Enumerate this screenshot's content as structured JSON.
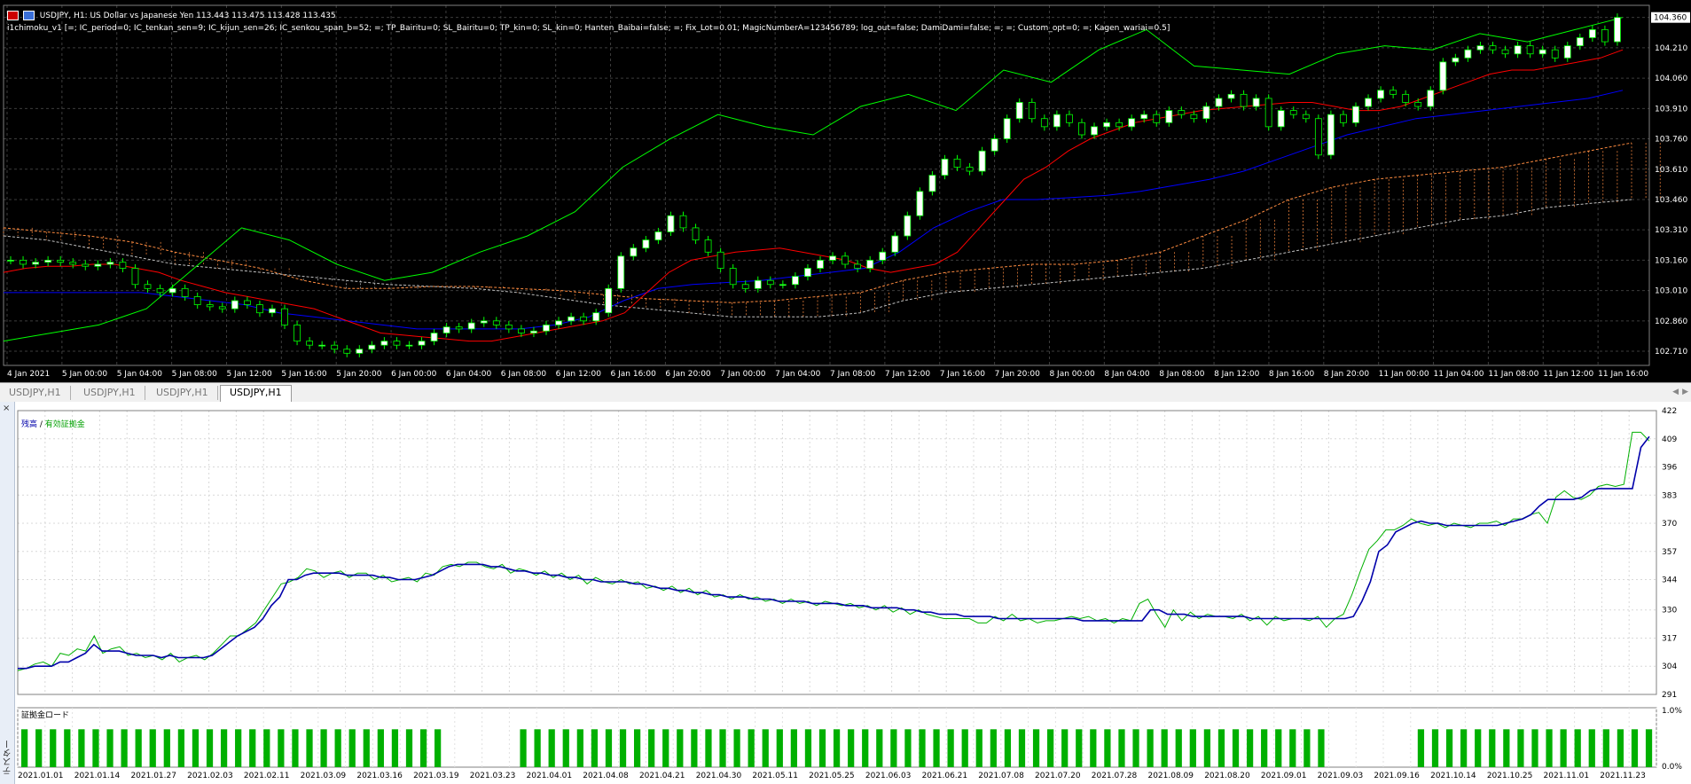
{
  "window": {
    "title_line": "USDJPY, H1:  US Dollar vs Japanese Yen  113.443 113.475 113.428 113.435",
    "indicator_line": "i1chimoku_v1 [=; IC_period=0; IC_tenkan_sen=9; IC_kijun_sen=26; IC_senkou_span_b=52; =; TP_Bairitu=0; SL_Bairitu=0; TP_kin=0; SL_kin=0; Hanten_Baibai=false; =; Fix_Lot=0.01; MagicNumberA=123456789; log_out=false; DamiDami=false; =; =; Custom_opt=0; =; Kagen_wariai=0.5]"
  },
  "price_axis": {
    "labels": [
      "104.360",
      "104.210",
      "104.060",
      "103.910",
      "103.760",
      "103.610",
      "103.460",
      "103.310",
      "103.160",
      "103.010",
      "102.860",
      "102.710"
    ],
    "current_price": "104.360"
  },
  "time_axis": {
    "labels": [
      "4 Jan 2021",
      "5 Jan 00:00",
      "5 Jan 04:00",
      "5 Jan 08:00",
      "5 Jan 12:00",
      "5 Jan 16:00",
      "5 Jan 20:00",
      "6 Jan 00:00",
      "6 Jan 04:00",
      "6 Jan 08:00",
      "6 Jan 12:00",
      "6 Jan 16:00",
      "6 Jan 20:00",
      "7 Jan 00:00",
      "7 Jan 04:00",
      "7 Jan 08:00",
      "7 Jan 12:00",
      "7 Jan 16:00",
      "7 Jan 20:00",
      "8 Jan 00:00",
      "8 Jan 04:00",
      "8 Jan 08:00",
      "8 Jan 12:00",
      "8 Jan 16:00",
      "8 Jan 20:00",
      "11 Jan 00:00",
      "11 Jan 04:00",
      "11 Jan 08:00",
      "11 Jan 12:00",
      "11 Jan 16:00"
    ]
  },
  "tabs": [
    {
      "label": "USDJPY,H1",
      "active": false
    },
    {
      "label": "USDJPY,H1",
      "active": false
    },
    {
      "label": "USDJPY,H1",
      "active": false
    },
    {
      "label": "USDJPY,H1",
      "active": true
    }
  ],
  "tester": {
    "side_label": "テスター",
    "close_symbol": "×",
    "balance_legend_a": "残高",
    "balance_legend_sep": " / ",
    "balance_legend_b": "有効証拠金",
    "margin_legend": "証拠金ロード",
    "balance_axis": [
      "422",
      "409",
      "396",
      "383",
      "370",
      "357",
      "344",
      "330",
      "317",
      "304",
      "291"
    ],
    "margin_axis": [
      "1.0%",
      "0.0%"
    ],
    "date_labels": [
      "2021.01.01",
      "2021.01.14",
      "2021.01.27",
      "2021.02.03",
      "2021.02.11",
      "2021.03.09",
      "2021.03.16",
      "2021.03.19",
      "2021.03.23",
      "2021.04.01",
      "2021.04.08",
      "2021.04.21",
      "2021.04.30",
      "2021.05.11",
      "2021.05.25",
      "2021.06.03",
      "2021.06.21",
      "2021.07.08",
      "2021.07.20",
      "2021.07.28",
      "2021.08.09",
      "2021.08.20",
      "2021.09.01",
      "2021.09.03",
      "2021.09.16",
      "2021.10.14",
      "2021.10.25",
      "2021.11.01",
      "2021.11.23"
    ]
  },
  "colors": {
    "bull_candle": "#ffffff",
    "bear_candle": "#000000",
    "candle_outline": "#00ff00",
    "tenkan": "#ff0000",
    "kijun": "#0000ff",
    "chikou": "#00ff00",
    "cloud_a": "#ff8c40",
    "cloud_b": "#c0c0c0",
    "balance": "#0000aa",
    "equity": "#00b000",
    "margin_bar": "#00b000"
  },
  "chart_data": [
    {
      "type": "candlestick",
      "title": "USDJPY, H1",
      "ylim": [
        102.64,
        104.42
      ],
      "x_range": [
        "4 Jan 2021",
        "11 Jan 16:00"
      ],
      "grid": true,
      "open": [
        103.16,
        103.16,
        103.14,
        103.15,
        103.16,
        103.15,
        103.14,
        103.13,
        103.14,
        103.15,
        103.12,
        103.04,
        103.02,
        103.0,
        103.02,
        102.98,
        102.94,
        102.93,
        102.92,
        102.96,
        102.94,
        102.9,
        102.92,
        102.84,
        102.76,
        102.74,
        102.74,
        102.72,
        102.7,
        102.72,
        102.74,
        102.76,
        102.74,
        102.74,
        102.76,
        102.8,
        102.83,
        102.82,
        102.85,
        102.86,
        102.84,
        102.82,
        102.8,
        102.81,
        102.84,
        102.86,
        102.88,
        102.86,
        102.9,
        103.02,
        103.18,
        103.22,
        103.26,
        103.3,
        103.38,
        103.32,
        103.26,
        103.2,
        103.12,
        103.04,
        103.02,
        103.06,
        103.04,
        103.04,
        103.08,
        103.12,
        103.16,
        103.18,
        103.14,
        103.12,
        103.16,
        103.2,
        103.28,
        103.38,
        103.5,
        103.58,
        103.66,
        103.62,
        103.6,
        103.7,
        103.76,
        103.86,
        103.94,
        103.86,
        103.82,
        103.88,
        103.84,
        103.78,
        103.82,
        103.84,
        103.82,
        103.86,
        103.88,
        103.84,
        103.9,
        103.88,
        103.86,
        103.92,
        103.96,
        103.98,
        103.92,
        103.96,
        103.82,
        103.9,
        103.88,
        103.86,
        103.68,
        103.88,
        103.84,
        103.92,
        103.96,
        104.0,
        103.98,
        103.94,
        103.92,
        104.0,
        104.14,
        104.16,
        104.2,
        104.22,
        104.2,
        104.18,
        104.22,
        104.18,
        104.2,
        104.16,
        104.22,
        104.26,
        104.3,
        104.24
      ],
      "close": [
        103.16,
        103.14,
        103.15,
        103.16,
        103.15,
        103.14,
        103.13,
        103.14,
        103.15,
        103.12,
        103.04,
        103.02,
        103.0,
        103.02,
        102.98,
        102.94,
        102.93,
        102.92,
        102.96,
        102.94,
        102.9,
        102.92,
        102.84,
        102.76,
        102.74,
        102.74,
        102.72,
        102.7,
        102.72,
        102.74,
        102.76,
        102.74,
        102.74,
        102.76,
        102.8,
        102.83,
        102.82,
        102.85,
        102.86,
        102.84,
        102.82,
        102.8,
        102.81,
        102.84,
        102.86,
        102.88,
        102.86,
        102.9,
        103.02,
        103.18,
        103.22,
        103.26,
        103.3,
        103.38,
        103.32,
        103.26,
        103.2,
        103.12,
        103.04,
        103.02,
        103.06,
        103.04,
        103.04,
        103.08,
        103.12,
        103.16,
        103.18,
        103.14,
        103.12,
        103.16,
        103.2,
        103.28,
        103.38,
        103.5,
        103.58,
        103.66,
        103.62,
        103.6,
        103.7,
        103.76,
        103.86,
        103.94,
        103.86,
        103.82,
        103.88,
        103.84,
        103.78,
        103.82,
        103.84,
        103.82,
        103.86,
        103.88,
        103.84,
        103.9,
        103.88,
        103.86,
        103.92,
        103.96,
        103.98,
        103.92,
        103.96,
        103.82,
        103.9,
        103.88,
        103.86,
        103.68,
        103.88,
        103.84,
        103.92,
        103.96,
        104.0,
        103.98,
        103.94,
        103.92,
        104.0,
        104.14,
        104.16,
        104.2,
        104.22,
        104.2,
        104.18,
        104.22,
        104.18,
        104.2,
        104.16,
        104.22,
        104.26,
        104.3,
        104.24,
        104.36
      ],
      "tenkan": [
        103.1,
        103.12,
        103.13,
        103.13,
        103.14,
        103.14,
        103.12,
        103.1,
        103.06,
        103.03,
        103.0,
        102.98,
        102.96,
        102.94,
        102.92,
        102.88,
        102.84,
        102.8,
        102.79,
        102.78,
        102.77,
        102.76,
        102.76,
        102.78,
        102.8,
        102.82,
        102.84,
        102.86,
        102.9,
        103.0,
        103.1,
        103.16,
        103.18,
        103.2,
        103.21,
        103.22,
        103.2,
        103.18,
        103.16,
        103.12,
        103.1,
        103.12,
        103.14,
        103.2,
        103.32,
        103.44,
        103.56,
        103.62,
        103.7,
        103.76,
        103.8,
        103.84,
        103.86,
        103.88,
        103.9,
        103.91,
        103.92,
        103.93,
        103.94,
        103.94,
        103.92,
        103.9,
        103.9,
        103.92,
        103.96,
        104.0,
        104.04,
        104.08,
        104.1,
        104.1,
        104.12,
        104.14,
        104.16,
        104.2
      ],
      "kijun": [
        103.0,
        103.0,
        103.0,
        103.0,
        103.0,
        102.98,
        102.96,
        102.94,
        102.9,
        102.88,
        102.86,
        102.84,
        102.82,
        102.82,
        102.82,
        102.82,
        102.84,
        102.88,
        102.96,
        103.02,
        103.04,
        103.05,
        103.06,
        103.08,
        103.1,
        103.12,
        103.2,
        103.32,
        103.4,
        103.46,
        103.46,
        103.47,
        103.48,
        103.5,
        103.53,
        103.56,
        103.6,
        103.66,
        103.72,
        103.78,
        103.82,
        103.86,
        103.88,
        103.9,
        103.92,
        103.94,
        103.96,
        104.0
      ],
      "chikou": [
        102.76,
        102.8,
        102.84,
        102.92,
        103.12,
        103.32,
        103.26,
        103.14,
        103.06,
        103.1,
        103.2,
        103.28,
        103.4,
        103.62,
        103.76,
        103.88,
        103.82,
        103.78,
        103.92,
        103.98,
        103.9,
        104.1,
        104.04,
        104.2,
        104.3,
        104.12,
        104.1,
        104.08,
        104.18,
        104.22,
        104.2,
        104.28,
        104.24,
        104.3,
        104.36
      ],
      "senkou_a": [
        103.32,
        103.3,
        103.28,
        103.25,
        103.2,
        103.16,
        103.12,
        103.06,
        103.02,
        103.02,
        103.03,
        103.03,
        103.02,
        103.01,
        102.99,
        102.97,
        102.96,
        102.95,
        102.96,
        102.98,
        103.0,
        103.06,
        103.1,
        103.12,
        103.14,
        103.14,
        103.16,
        103.2,
        103.28,
        103.36,
        103.46,
        103.52,
        103.56,
        103.58,
        103.6,
        103.62,
        103.66,
        103.7,
        103.74
      ],
      "senkou_b": [
        103.28,
        103.26,
        103.22,
        103.18,
        103.14,
        103.12,
        103.1,
        103.08,
        103.06,
        103.04,
        103.03,
        103.02,
        103.0,
        102.97,
        102.94,
        102.92,
        102.9,
        102.88,
        102.88,
        102.88,
        102.9,
        102.96,
        103.0,
        103.02,
        103.04,
        103.06,
        103.08,
        103.1,
        103.12,
        103.16,
        103.2,
        103.24,
        103.28,
        103.32,
        103.36,
        103.38,
        103.42,
        103.44,
        103.46
      ]
    },
    {
      "type": "line",
      "title": "残高 / 有効証拠金",
      "ylim": [
        291,
        422
      ],
      "x_range": [
        "2021.01.01",
        "2021.11.23"
      ],
      "series": [
        {
          "name": "残高",
          "values": [
            303,
            303,
            304,
            304,
            304,
            306,
            306,
            308,
            310,
            314,
            311,
            311,
            311,
            310,
            309,
            309,
            309,
            308,
            309,
            308,
            308,
            308,
            308,
            309,
            312,
            315,
            318,
            320,
            322,
            326,
            332,
            336,
            344,
            344,
            346,
            347,
            347,
            347,
            347,
            346,
            346,
            346,
            346,
            345,
            345,
            344,
            344,
            344,
            345,
            346,
            348,
            350,
            351,
            351,
            351,
            351,
            350,
            350,
            349,
            348,
            348,
            347,
            347,
            346,
            346,
            345,
            345,
            344,
            344,
            343,
            343,
            343,
            343,
            342,
            342,
            341,
            340,
            340,
            339,
            339,
            338,
            338,
            337,
            337,
            336,
            336,
            336,
            335,
            335,
            335,
            334,
            334,
            334,
            334,
            333,
            333,
            333,
            333,
            332,
            332,
            332,
            331,
            331,
            331,
            331,
            330,
            330,
            329,
            329,
            328,
            328,
            328,
            327,
            327,
            327,
            327,
            326,
            326,
            326,
            326,
            326,
            326,
            326,
            326,
            326,
            326,
            325,
            325,
            325,
            325,
            325,
            325,
            325,
            325,
            330,
            330,
            328,
            328,
            328,
            327,
            327,
            327,
            327,
            327,
            327,
            327,
            326,
            326,
            326,
            326,
            326,
            326,
            326,
            326,
            326,
            326,
            326,
            326,
            327,
            334,
            343,
            357,
            360,
            366,
            368,
            370,
            371,
            370,
            370,
            369,
            369,
            369,
            369,
            369,
            369,
            369,
            370,
            371,
            372,
            374,
            378,
            381,
            381,
            381,
            381,
            382,
            385,
            386,
            386,
            386,
            386,
            386,
            405,
            410
          ]
        },
        {
          "name": "有効証拠金",
          "values": [
            302,
            303,
            305,
            306,
            304,
            310,
            309,
            312,
            311,
            318,
            310,
            312,
            313,
            309,
            310,
            308,
            309,
            307,
            310,
            306,
            308,
            309,
            307,
            310,
            314,
            318,
            318,
            321,
            324,
            330,
            336,
            342,
            343,
            345,
            349,
            348,
            345,
            347,
            348,
            345,
            347,
            347,
            344,
            346,
            343,
            344,
            345,
            343,
            347,
            346,
            350,
            351,
            350,
            352,
            352,
            350,
            349,
            351,
            347,
            349,
            348,
            346,
            348,
            345,
            347,
            344,
            346,
            342,
            345,
            343,
            342,
            344,
            342,
            343,
            340,
            341,
            339,
            341,
            338,
            340,
            337,
            339,
            336,
            337,
            335,
            337,
            335,
            336,
            334,
            335,
            333,
            335,
            333,
            334,
            332,
            334,
            333,
            332,
            333,
            331,
            332,
            330,
            332,
            329,
            331,
            328,
            330,
            328,
            327,
            326,
            326,
            326,
            326,
            324,
            324,
            327,
            325,
            328,
            325,
            326,
            324,
            325,
            325,
            326,
            327,
            326,
            327,
            325,
            326,
            324,
            326,
            325,
            333,
            335,
            328,
            322,
            330,
            325,
            329,
            326,
            328,
            327,
            327,
            326,
            328,
            325,
            327,
            323,
            327,
            325,
            326,
            326,
            325,
            327,
            322,
            326,
            328,
            337,
            348,
            358,
            362,
            367,
            367,
            369,
            372,
            370,
            369,
            370,
            368,
            370,
            369,
            368,
            370,
            370,
            371,
            369,
            372,
            372,
            374,
            375,
            370,
            382,
            385,
            382,
            381,
            383,
            387,
            388,
            387,
            388,
            412,
            412,
            408
          ]
        }
      ]
    },
    {
      "type": "bar",
      "title": "証拠金ロード",
      "ylim": [
        0,
        1.0
      ],
      "ylabel": "%",
      "values": [
        0.7,
        0.7,
        0.7,
        0.7,
        0.7,
        0.7,
        0.7,
        0.7,
        0.7,
        0.7,
        0.7,
        0.7,
        0.7,
        0.7,
        0.7,
        0.7,
        0.7,
        0.7,
        0.7,
        0.7,
        0.7,
        0.7,
        0.7,
        0.7,
        0.7,
        0.7,
        0.7,
        0.7,
        0.7,
        0.7,
        0.7,
        0.7,
        0.7,
        0.7,
        0.7,
        0.7,
        0.7,
        0.7,
        0.7,
        0.7,
        0.7,
        0.7,
        0.7,
        0.7,
        0.7,
        0.7,
        0.7,
        0.7,
        0.7,
        0.7,
        0.7,
        0.7,
        0.7,
        0.7,
        0.7,
        0.7,
        0.7,
        0.7,
        0.7,
        0.7,
        0.7,
        0.7,
        0.7,
        0.7,
        0.7,
        0.7,
        0.7,
        0.7,
        0.7,
        0.7,
        0.7,
        0.7,
        0.7,
        0.7,
        0.7,
        0.7,
        0.7,
        0.7,
        0.7,
        0.7,
        0.7,
        0.7,
        0.7,
        0.7,
        0.7,
        0.7,
        0.7,
        0.7,
        0.7,
        0.7,
        0.7,
        0.7,
        0.7,
        0.7,
        0.7,
        0.7,
        0.7,
        0.7,
        0.7,
        0.7,
        0.7,
        0.7,
        0.7,
        0.7,
        0.7,
        0.7,
        0.7,
        0.7,
        0.7,
        0.7,
        0.7,
        0.7,
        0.7,
        0.7,
        0.7
      ]
    }
  ]
}
